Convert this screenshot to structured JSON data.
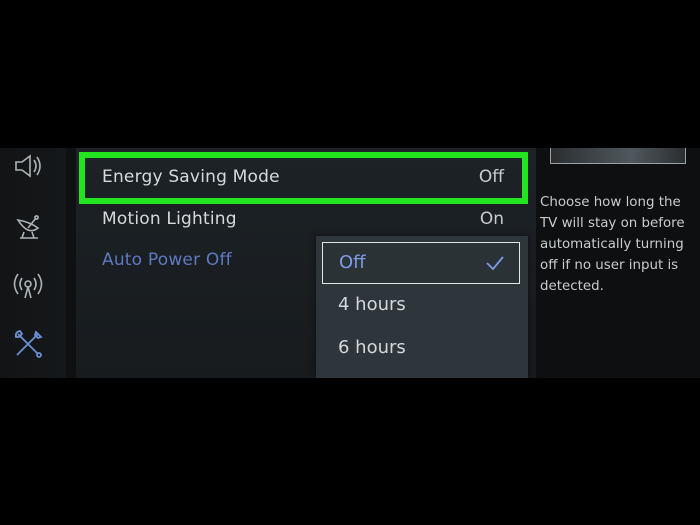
{
  "sidebar": {
    "icons": [
      {
        "name": "sound-icon"
      },
      {
        "name": "broadcast-icon"
      },
      {
        "name": "network-icon"
      },
      {
        "name": "tools-icon"
      }
    ]
  },
  "menu": {
    "items": [
      {
        "label": "Energy Saving Mode",
        "value": "Off"
      },
      {
        "label": "Motion Lighting",
        "value": "On"
      },
      {
        "label": "Auto Power Off",
        "value": ""
      }
    ]
  },
  "dropdown": {
    "options": [
      {
        "label": "Off",
        "selected": true
      },
      {
        "label": "4 hours",
        "selected": false
      },
      {
        "label": "6 hours",
        "selected": false
      }
    ]
  },
  "help": {
    "text": "Choose how long the TV will stay on before automatically turning off if no user input is detected."
  },
  "colors": {
    "highlight": "#22e41f",
    "active_label": "#5d79c2",
    "selected_option": "#7a9ce8"
  }
}
